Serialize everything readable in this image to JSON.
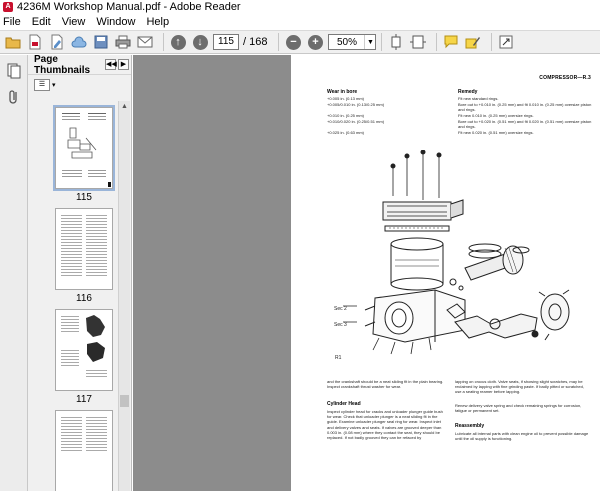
{
  "window": {
    "title": "4236M Workshop Manual.pdf - Adobe Reader"
  },
  "menu": [
    "File",
    "Edit",
    "View",
    "Window",
    "Help"
  ],
  "toolbar": {
    "page_current": "115",
    "page_total": "/ 168",
    "zoom": "50%"
  },
  "panel": {
    "title": "Page Thumbnails",
    "thumbnails": [
      {
        "label": "115"
      },
      {
        "label": "116"
      },
      {
        "label": "117"
      }
    ]
  },
  "document": {
    "header": "COMPRESSOR—R.3",
    "col_wear": "Wear in bore",
    "col_remedy": "Remedy",
    "rows": [
      {
        "wear": "+0.005 in. (0.13 mm)",
        "remedy": "Fit new standard rings."
      },
      {
        "wear": "+0.005/0.010 in. (0.13/0.25 mm)",
        "remedy": "Bore out to +0.010 in. (0.25 mm) and fit 0.010 in. (0.25 mm) oversize piston and rings."
      },
      {
        "wear": "+0.010 in. (0.25 mm)",
        "remedy": "Fit new 0.010 in. (0.25 mm) oversize rings."
      },
      {
        "wear": "+0.010/0.020 in. (0.25/0.51 mm)",
        "remedy": "Bore out to +0.020 in. (0.51 mm) and fit 0.020 in. (0.51 mm) oversize piston and rings."
      },
      {
        "wear": "+0.025 in. (0.63 mm)",
        "remedy": "Fit new 0.020 in. (0.51 mm) oversize rings."
      }
    ],
    "figure_label": "R1",
    "callout_a": "Sec 2",
    "callout_b": "Sec 3",
    "para_left_1": "and the crankshaft should be a neat sliding fit in the plain bearing. Inspect crankshaft thrust washer for wear.",
    "section_cylinder_head": "Cylinder Head",
    "para_left_2": "Inspect cylinder head for cracks and unloader plunger guide bush for wear. Check that unloader plunger is a neat sliding fit in the guide. Examine unloader plunger seal ring for wear. Inspect inlet and delivery valves and seats. If valves are grooved deeper than 0.003 in. (0.08 mm) where they contact the seat, they should be replaced. If not badly grooved they can be refaced by",
    "para_right_1": "lapping on crocus cloth. Valve seats, if showing slight scratches, may be reclaimed by lapping with fine grinding paste. If badly pitted or scratched, use a seating reamer before lapping.",
    "para_right_2": "Renew delivery valve spring and check remaining springs for corrosion, fatigue or permanent set.",
    "section_reassembly": "Reassembly",
    "para_right_3": "Lubricate all internal parts with clean engine oil to prevent possible damage until the oil supply is functioning."
  },
  "colors": {
    "doc_background": "#8c8c8c",
    "toolbar": "#f0f0f0",
    "pdf_red": "#c8102e"
  }
}
